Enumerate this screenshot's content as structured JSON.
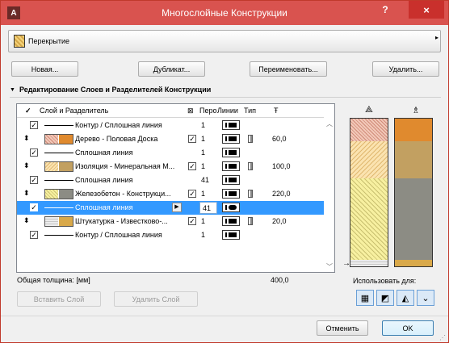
{
  "window": {
    "title": "Многослойные Конструкции",
    "help": "?",
    "close": "×",
    "app_icon": "A"
  },
  "structure_type": {
    "label": "Перекрытие",
    "arrow": "▸"
  },
  "top_buttons": {
    "new": "Новая...",
    "duplicate": "Дубликат...",
    "rename": "Переименовать...",
    "delete": "Удалить..."
  },
  "section": {
    "title": "Редактирование Слоев и Разделителей Конструкции",
    "arrow": "▼"
  },
  "columns": {
    "check": "✓",
    "name": "Слой и Разделитель",
    "flag": "⊠",
    "pen": "Перо",
    "lines": "Линии",
    "type": "Тип",
    "thickness": "Ŧ"
  },
  "rows": [
    {
      "kind": "separator",
      "checked": true,
      "name": "Контур / Сплошная линия",
      "pen": "1",
      "selected": false
    },
    {
      "kind": "layer",
      "handle": "⬍",
      "name": "Дерево - Половая Доска",
      "checked2": true,
      "pen": "1",
      "thickness": "60,0",
      "hatch_color": "#f2c8b8",
      "fill_color": "#e08a2e",
      "selected": false
    },
    {
      "kind": "separator",
      "checked": true,
      "name": "Сплошная линия",
      "pen": "1",
      "selected": false
    },
    {
      "kind": "layer",
      "handle": "⬍",
      "name": "Изоляция - Минеральная М...",
      "checked2": true,
      "pen": "1",
      "thickness": "100,0",
      "hatch_color": "#fbe3b0",
      "fill_color": "#c2a061",
      "selected": false
    },
    {
      "kind": "separator",
      "checked": true,
      "name": "Сплошная линия",
      "pen": "41",
      "selected": false
    },
    {
      "kind": "layer",
      "handle": "⬍",
      "name": "Железобетон - Конструкци...",
      "checked2": true,
      "pen": "1",
      "thickness": "220,0",
      "hatch_color": "#f7f0a0",
      "fill_color": "#8c8c84",
      "selected": false
    },
    {
      "kind": "separator",
      "checked": true,
      "name": "Сплошная линия",
      "pen": "41",
      "selected": true
    },
    {
      "kind": "layer",
      "handle": "⬍",
      "name": "Штукатурка - Известково-...",
      "checked2": true,
      "pen": "1",
      "thickness": "20,0",
      "hatch_color": "#ececec",
      "fill_color": "#d9a94a",
      "selected": false
    },
    {
      "kind": "separator",
      "checked": true,
      "name": "Контур / Сплошная линия",
      "pen": "1",
      "selected": false
    }
  ],
  "total": {
    "label": "Общая толщина: [мм]",
    "value": "400,0"
  },
  "bottom_buttons": {
    "insert_layer": "Вставить Слой",
    "delete_layer": "Удалить Слой"
  },
  "use_for": {
    "label": "Использовать для:"
  },
  "preview": {
    "icon_left": "⟁",
    "icon_right": "♗",
    "pointer": "→"
  },
  "dialog_buttons": {
    "cancel": "Отменить",
    "ok": "OK"
  },
  "colors": {
    "titlebar": "#d9534f",
    "close": "#c9302c",
    "selection": "#3399ff",
    "wood_fill": "#e08a2e",
    "insulation_fill": "#c2a061",
    "concrete_fill": "#8c8c84",
    "plaster_fill": "#d9a94a"
  }
}
